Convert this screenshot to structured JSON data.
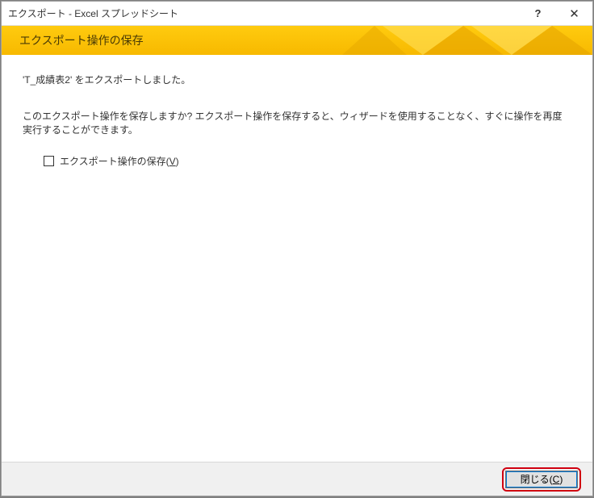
{
  "titlebar": {
    "title": "エクスポート - Excel スプレッドシート",
    "help_label": "?",
    "close_label": "✕"
  },
  "header": {
    "title": "エクスポート操作の保存"
  },
  "content": {
    "line1": "'T_成績表2' をエクスポートしました。",
    "line2": "このエクスポート操作を保存しますか? エクスポート操作を保存すると、ウィザードを使用することなく、すぐに操作を再度実行することができます。",
    "checkbox_label_pre": "エクスポート操作の保存(",
    "checkbox_accel": "V",
    "checkbox_label_post": ")"
  },
  "buttons": {
    "close_pre": "閉じる(",
    "close_accel": "C",
    "close_post": ")"
  }
}
